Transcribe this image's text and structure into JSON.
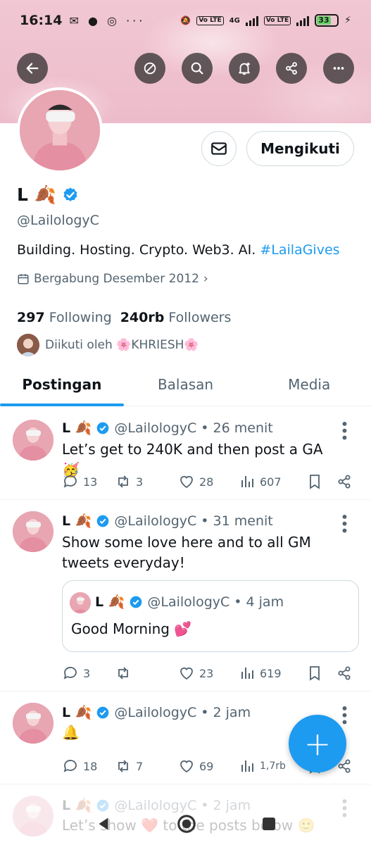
{
  "status_bar": {
    "time": "16:14",
    "notif_icons": "✉ ● ◎ ···",
    "net1": "Vo LTE",
    "net2": "4G",
    "net3": "Vo LTE",
    "battery": "33"
  },
  "header": {
    "back_icon": "back-arrow-icon",
    "icons": [
      "hide-icon",
      "search-icon",
      "bell-plus-icon",
      "share-icon",
      "more-icon"
    ]
  },
  "profile": {
    "name": "L 🍂",
    "handle": "@LailologyC",
    "bio_text": "Building. Hosting. Crypto. Web3. AI. ",
    "bio_hashtag": "#LailaGives",
    "joined": "Bergabung Desember 2012",
    "following_count": "297",
    "following_label": "Following",
    "followers_count": "240rb",
    "followers_label": "Followers",
    "followed_by": "Diikuti oleh 🌸KHRIESH🌸",
    "follow_button": "Mengikuti"
  },
  "tabs": [
    "Postingan",
    "Balasan",
    "Media"
  ],
  "tweets": [
    {
      "name": "L 🍂",
      "handle": "@LailologyC",
      "time": "• 26 menit",
      "text": "Let’s get to 240K and then post a GA 🥳",
      "replies": "13",
      "retweets": "3",
      "likes": "28",
      "views": "607"
    },
    {
      "name": "L 🍂",
      "handle": "@LailologyC",
      "time": "• 31 menit",
      "text": "Show some love here and to all GM tweets everyday!",
      "quote": {
        "name": "L 🍂",
        "handle": "@LailologyC",
        "time": "• 4 jam",
        "text": "Good Morning 💕"
      },
      "replies": "3",
      "retweets": "",
      "likes": "23",
      "views": "619"
    },
    {
      "name": "L 🍂",
      "handle": "@LailologyC",
      "time": "• 2 jam",
      "text": "🔔",
      "replies": "18",
      "retweets": "7",
      "likes": "69",
      "views": "1,7rb"
    },
    {
      "name": "L 🍂",
      "handle": "@LailologyC",
      "time": "• 2 jam",
      "text": "Let’s show ❤️ to the posts below 🙂"
    }
  ],
  "colors": {
    "accent": "#1d9bf0",
    "text": "#0f1419",
    "muted": "#536471",
    "banner": "#efc3d0"
  }
}
